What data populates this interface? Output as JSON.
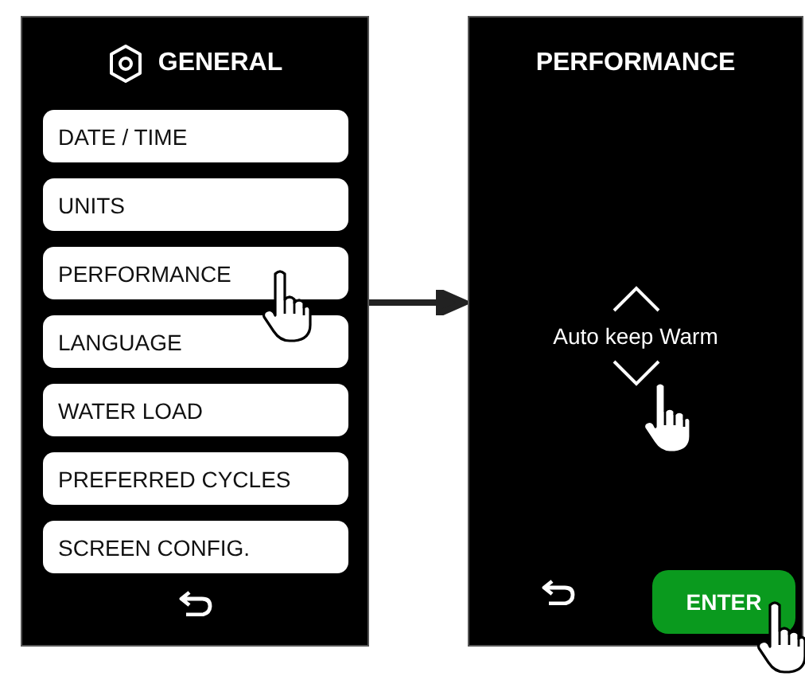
{
  "general_screen": {
    "title": "GENERAL",
    "items": [
      {
        "label": "DATE / TIME"
      },
      {
        "label": "UNITS"
      },
      {
        "label": "PERFORMANCE"
      },
      {
        "label": "LANGUAGE"
      },
      {
        "label": "WATER LOAD"
      },
      {
        "label": "PREFERRED CYCLES"
      },
      {
        "label": "SCREEN CONFIG."
      }
    ]
  },
  "performance_screen": {
    "title": "PERFORMANCE",
    "option": "Auto keep Warm",
    "enter_button": "ENTER"
  }
}
